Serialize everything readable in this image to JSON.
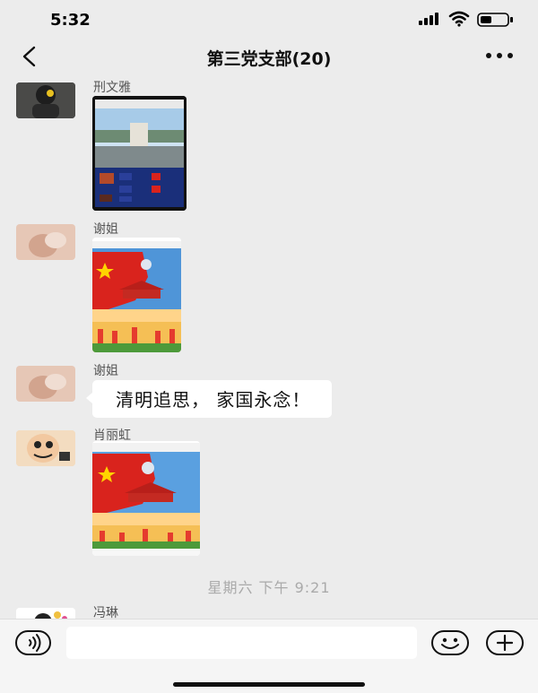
{
  "status_bar": {
    "time": "5:32"
  },
  "header": {
    "title": "第三党支部(20)"
  },
  "messages": [
    {
      "sender": "刑文雅",
      "type": "image"
    },
    {
      "sender": "谢姐",
      "type": "image"
    },
    {
      "sender": "谢姐",
      "type": "text",
      "text": "清明追思， 家国永念！"
    },
    {
      "sender": "肖丽虹",
      "type": "image"
    },
    {
      "sender": "冯琳",
      "type": "partial"
    }
  ],
  "system_time": "星期六 下午 9:21",
  "input": {
    "value": ""
  },
  "icons": {
    "back": "chevron-left-icon",
    "more": "more-dots-icon",
    "voice": "voice-icon",
    "emoji": "emoji-icon",
    "plus": "plus-icon"
  },
  "colors": {
    "background": "#ececec",
    "bubble": "#ffffff",
    "red": "#d9231d",
    "navy": "#1a2f7a"
  }
}
